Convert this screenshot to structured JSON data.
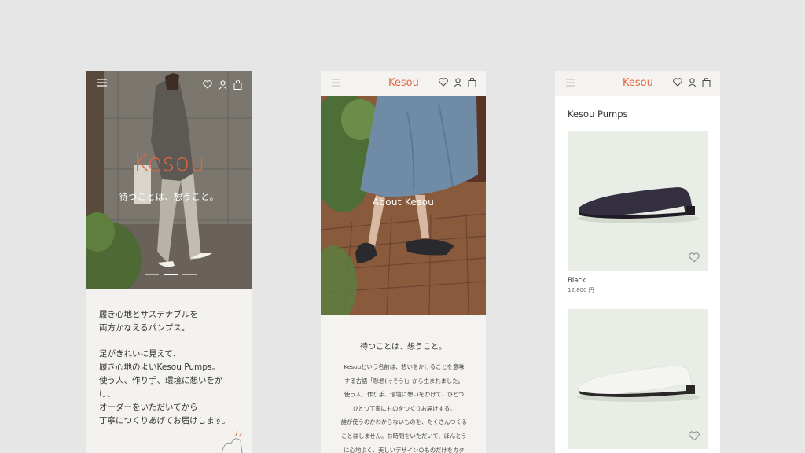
{
  "screen1": {
    "brand": "Kesou",
    "tagline": "待つことは、想うこと。",
    "copy": [
      "履き心地とサステナブルを\n両方かなえるパンプス。",
      "足がきれいに見えて、\n履き心地のよいKesou Pumps。\n使う人、作り手、環境に想いをか\nけ、\nオーダーをいただいてから\n丁寧につくりあげてお届けします。"
    ],
    "icons": [
      "menu-icon",
      "heart-icon",
      "user-icon",
      "bag-icon"
    ]
  },
  "screen2": {
    "logo": "Kesou",
    "hero_overlay": "About Kesou",
    "title": "待つことは、想うこと。",
    "body": [
      "Kesouという名前は、想いをかけることを意味",
      "する古語「懸想(けそう)」から生まれました。",
      "使う人、作り手、環境に想いをかけて、ひとつ",
      "ひとつ丁寧にものをつくりお届けする。",
      "誰が使うのかわからないものを、たくさんつくる",
      "ことはしません。お時間をいただいて、ほんとう",
      "に心地よく、美しいデザインのものだけをカタ"
    ]
  },
  "screen3": {
    "logo": "Kesou",
    "title": "Kesou Pumps",
    "products": [
      {
        "name": "Black",
        "price": "12,800 円",
        "color": "#35303f"
      },
      {
        "name": "",
        "price": "",
        "color": "#f4f4f2"
      }
    ]
  },
  "colors": {
    "brand": "#e0663f",
    "background": "#e6e6e6"
  }
}
